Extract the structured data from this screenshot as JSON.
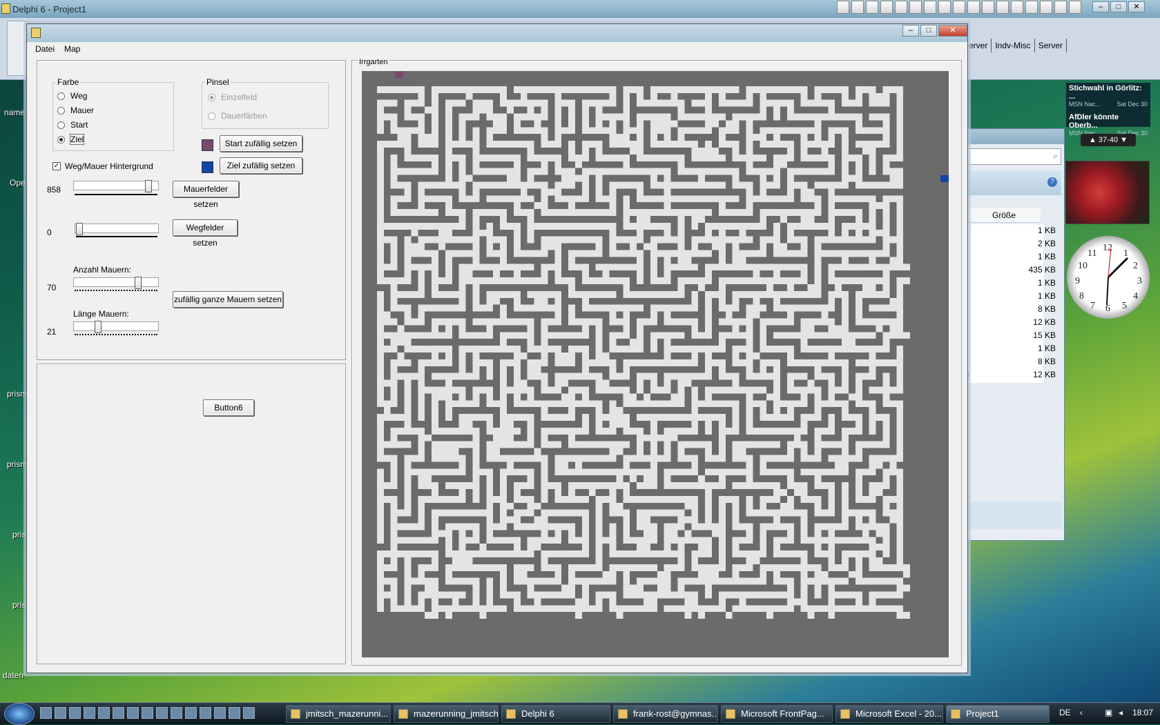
{
  "ide": {
    "title": "Delphi 6 - Project1",
    "component_tabs": [
      "erver",
      "Indv-Misc",
      "Server"
    ]
  },
  "desktop": {
    "labels": [
      "name",
      "Ope",
      "prism",
      "prism",
      "prism",
      "prism",
      "daten"
    ]
  },
  "sidebar": {
    "news": [
      {
        "title": "Stichwahl in Görlitz: ...",
        "source": "MSN Nac...",
        "date": "Sat Dec 30"
      },
      {
        "title": "AfDler könnte Oberb...",
        "source": "MSN Nac...",
        "date": "Sat Dec 30"
      }
    ],
    "pager": "37-40",
    "clock_numbers": [
      "12",
      "1",
      "2",
      "3",
      "4",
      "5",
      "6",
      "7",
      "8",
      "9",
      "10",
      "11"
    ]
  },
  "explorer": {
    "column_size": "Größe",
    "sizes": [
      "1 KB",
      "2 KB",
      "1 KB",
      "435 KB",
      "1 KB",
      "1 KB",
      "8 KB",
      "12 KB",
      "15 KB",
      "1 KB",
      "8 KB",
      "12 KB"
    ],
    "partial_row": "e"
  },
  "form": {
    "menu": [
      "Datei",
      "Map"
    ],
    "farbe": {
      "caption": "Farbe",
      "options": [
        "Weg",
        "Mauer",
        "Start",
        "Ziel"
      ],
      "selected": "Ziel"
    },
    "pinsel": {
      "caption": "Pinsel",
      "options": [
        "Einzelfeld",
        "Dauerfärben"
      ],
      "selected": "Einzelfeld"
    },
    "start_button": "Start zufällig setzen",
    "ziel_button": "Ziel zufällig setzen",
    "start_color": "#7a4a6e",
    "ziel_color": "#1044a8",
    "checkbox_label": "Weg/Mauer Hintergrund",
    "checkbox_checked": true,
    "mauerfelder_value": "858",
    "mauerfelder_button": "Mauerfelder setzen",
    "wegfelder_value": "0",
    "wegfelder_button": "Wegfelder setzen",
    "anzahl_label": "Anzahl Mauern:",
    "anzahl_value": "70",
    "laenge_label": "Länge Mauern:",
    "laenge_value": "21",
    "random_walls_button": "zufällig ganze Mauern setzen",
    "button6": "Button6",
    "maze_caption": "Irrgarten",
    "wall_color": "#6b6b6b",
    "path_color": "#e4e4e4"
  },
  "taskbar": {
    "tasks": [
      "jmitsch_mazerunni...",
      "mazerunning_jmitsch",
      "Delphi 6",
      "frank-rost@gymnas...",
      "Microsoft FrontPag...",
      "Microsoft Excel - 20...",
      "Project1"
    ],
    "active": "Project1",
    "lang": "DE",
    "time": "18:07"
  }
}
